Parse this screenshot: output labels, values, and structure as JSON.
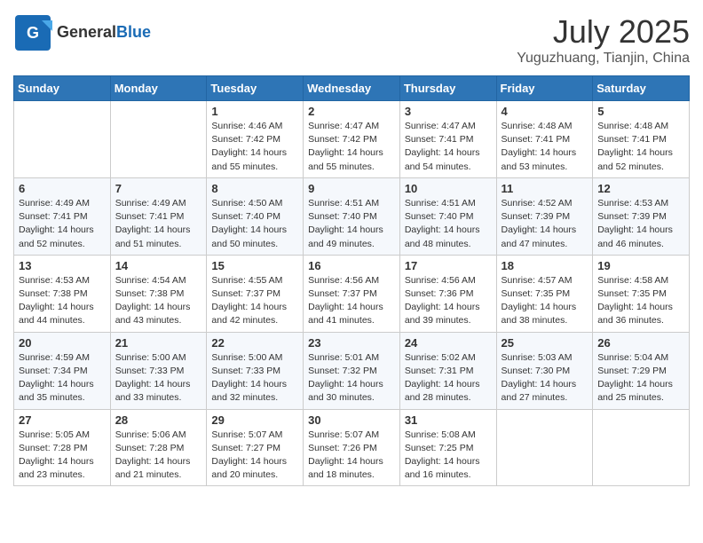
{
  "header": {
    "logo_general": "General",
    "logo_blue": "Blue",
    "month": "July 2025",
    "location": "Yuguzhuang, Tianjin, China"
  },
  "weekdays": [
    "Sunday",
    "Monday",
    "Tuesday",
    "Wednesday",
    "Thursday",
    "Friday",
    "Saturday"
  ],
  "weeks": [
    [
      {
        "day": "",
        "info": ""
      },
      {
        "day": "",
        "info": ""
      },
      {
        "day": "1",
        "info": "Sunrise: 4:46 AM\nSunset: 7:42 PM\nDaylight: 14 hours and 55 minutes."
      },
      {
        "day": "2",
        "info": "Sunrise: 4:47 AM\nSunset: 7:42 PM\nDaylight: 14 hours and 55 minutes."
      },
      {
        "day": "3",
        "info": "Sunrise: 4:47 AM\nSunset: 7:41 PM\nDaylight: 14 hours and 54 minutes."
      },
      {
        "day": "4",
        "info": "Sunrise: 4:48 AM\nSunset: 7:41 PM\nDaylight: 14 hours and 53 minutes."
      },
      {
        "day": "5",
        "info": "Sunrise: 4:48 AM\nSunset: 7:41 PM\nDaylight: 14 hours and 52 minutes."
      }
    ],
    [
      {
        "day": "6",
        "info": "Sunrise: 4:49 AM\nSunset: 7:41 PM\nDaylight: 14 hours and 52 minutes."
      },
      {
        "day": "7",
        "info": "Sunrise: 4:49 AM\nSunset: 7:41 PM\nDaylight: 14 hours and 51 minutes."
      },
      {
        "day": "8",
        "info": "Sunrise: 4:50 AM\nSunset: 7:40 PM\nDaylight: 14 hours and 50 minutes."
      },
      {
        "day": "9",
        "info": "Sunrise: 4:51 AM\nSunset: 7:40 PM\nDaylight: 14 hours and 49 minutes."
      },
      {
        "day": "10",
        "info": "Sunrise: 4:51 AM\nSunset: 7:40 PM\nDaylight: 14 hours and 48 minutes."
      },
      {
        "day": "11",
        "info": "Sunrise: 4:52 AM\nSunset: 7:39 PM\nDaylight: 14 hours and 47 minutes."
      },
      {
        "day": "12",
        "info": "Sunrise: 4:53 AM\nSunset: 7:39 PM\nDaylight: 14 hours and 46 minutes."
      }
    ],
    [
      {
        "day": "13",
        "info": "Sunrise: 4:53 AM\nSunset: 7:38 PM\nDaylight: 14 hours and 44 minutes."
      },
      {
        "day": "14",
        "info": "Sunrise: 4:54 AM\nSunset: 7:38 PM\nDaylight: 14 hours and 43 minutes."
      },
      {
        "day": "15",
        "info": "Sunrise: 4:55 AM\nSunset: 7:37 PM\nDaylight: 14 hours and 42 minutes."
      },
      {
        "day": "16",
        "info": "Sunrise: 4:56 AM\nSunset: 7:37 PM\nDaylight: 14 hours and 41 minutes."
      },
      {
        "day": "17",
        "info": "Sunrise: 4:56 AM\nSunset: 7:36 PM\nDaylight: 14 hours and 39 minutes."
      },
      {
        "day": "18",
        "info": "Sunrise: 4:57 AM\nSunset: 7:35 PM\nDaylight: 14 hours and 38 minutes."
      },
      {
        "day": "19",
        "info": "Sunrise: 4:58 AM\nSunset: 7:35 PM\nDaylight: 14 hours and 36 minutes."
      }
    ],
    [
      {
        "day": "20",
        "info": "Sunrise: 4:59 AM\nSunset: 7:34 PM\nDaylight: 14 hours and 35 minutes."
      },
      {
        "day": "21",
        "info": "Sunrise: 5:00 AM\nSunset: 7:33 PM\nDaylight: 14 hours and 33 minutes."
      },
      {
        "day": "22",
        "info": "Sunrise: 5:00 AM\nSunset: 7:33 PM\nDaylight: 14 hours and 32 minutes."
      },
      {
        "day": "23",
        "info": "Sunrise: 5:01 AM\nSunset: 7:32 PM\nDaylight: 14 hours and 30 minutes."
      },
      {
        "day": "24",
        "info": "Sunrise: 5:02 AM\nSunset: 7:31 PM\nDaylight: 14 hours and 28 minutes."
      },
      {
        "day": "25",
        "info": "Sunrise: 5:03 AM\nSunset: 7:30 PM\nDaylight: 14 hours and 27 minutes."
      },
      {
        "day": "26",
        "info": "Sunrise: 5:04 AM\nSunset: 7:29 PM\nDaylight: 14 hours and 25 minutes."
      }
    ],
    [
      {
        "day": "27",
        "info": "Sunrise: 5:05 AM\nSunset: 7:28 PM\nDaylight: 14 hours and 23 minutes."
      },
      {
        "day": "28",
        "info": "Sunrise: 5:06 AM\nSunset: 7:28 PM\nDaylight: 14 hours and 21 minutes."
      },
      {
        "day": "29",
        "info": "Sunrise: 5:07 AM\nSunset: 7:27 PM\nDaylight: 14 hours and 20 minutes."
      },
      {
        "day": "30",
        "info": "Sunrise: 5:07 AM\nSunset: 7:26 PM\nDaylight: 14 hours and 18 minutes."
      },
      {
        "day": "31",
        "info": "Sunrise: 5:08 AM\nSunset: 7:25 PM\nDaylight: 14 hours and 16 minutes."
      },
      {
        "day": "",
        "info": ""
      },
      {
        "day": "",
        "info": ""
      }
    ]
  ]
}
